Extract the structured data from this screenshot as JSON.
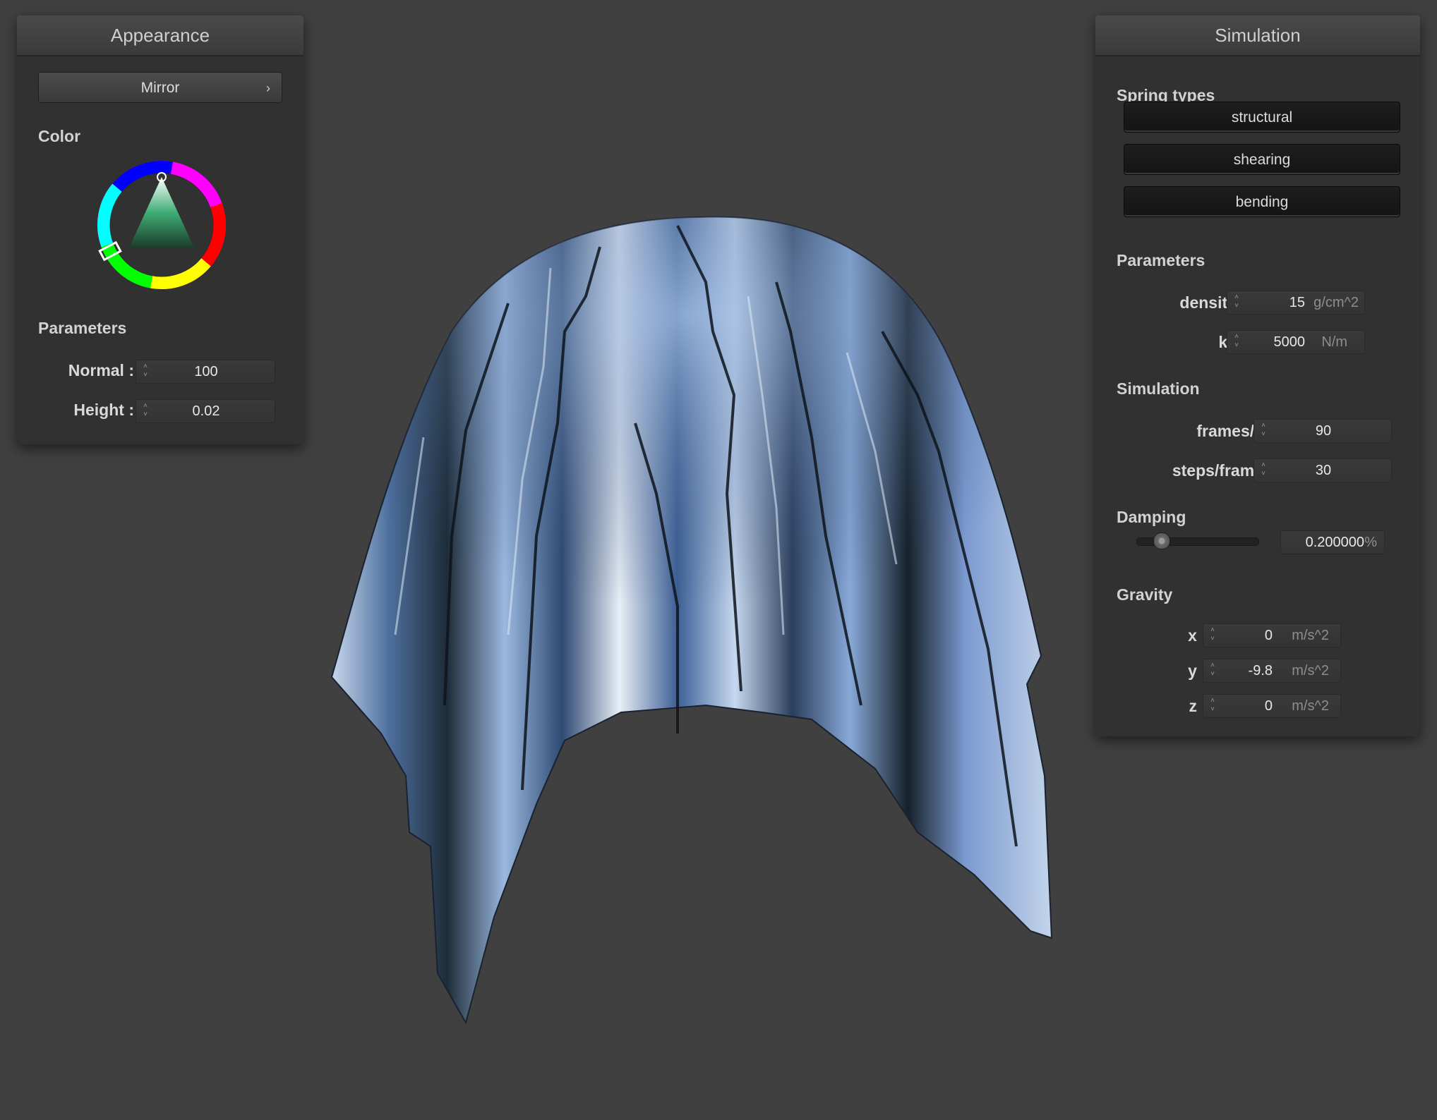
{
  "appearance": {
    "title": "Appearance",
    "material_button": "Mirror",
    "color_label": "Color",
    "parameters_label": "Parameters",
    "normal": {
      "label": "Normal :",
      "value": "100"
    },
    "height": {
      "label": "Height :",
      "value": "0.02"
    }
  },
  "simulation": {
    "title": "Simulation",
    "spring_types_label": "Spring types",
    "spring_buttons": [
      "structural",
      "shearing",
      "bending"
    ],
    "parameters_label": "Parameters",
    "density": {
      "label": "density :",
      "value": "15",
      "unit": "g/cm^2"
    },
    "ks": {
      "label": "ks :",
      "value": "5000",
      "unit": "N/m"
    },
    "simulation_label": "Simulation",
    "frames_per_s": {
      "label": "frames/s :",
      "value": "90"
    },
    "steps_per_frame": {
      "label": "steps/frame :",
      "value": "30"
    },
    "damping_label": "Damping",
    "damping": {
      "value": "0.200000",
      "unit": "%",
      "slider_fraction": 0.2
    },
    "gravity_label": "Gravity",
    "gravity": {
      "x": {
        "label": "x :",
        "value": "0",
        "unit": "m/s^2"
      },
      "y": {
        "label": "y :",
        "value": "-9.8",
        "unit": "m/s^2"
      },
      "z": {
        "label": "z :",
        "value": "0",
        "unit": "m/s^2"
      }
    }
  },
  "colors": {
    "background": "#404040",
    "panel": "#313131",
    "cloth_base": "#6f93c8",
    "color_picker_triangle": "#3fae75"
  }
}
